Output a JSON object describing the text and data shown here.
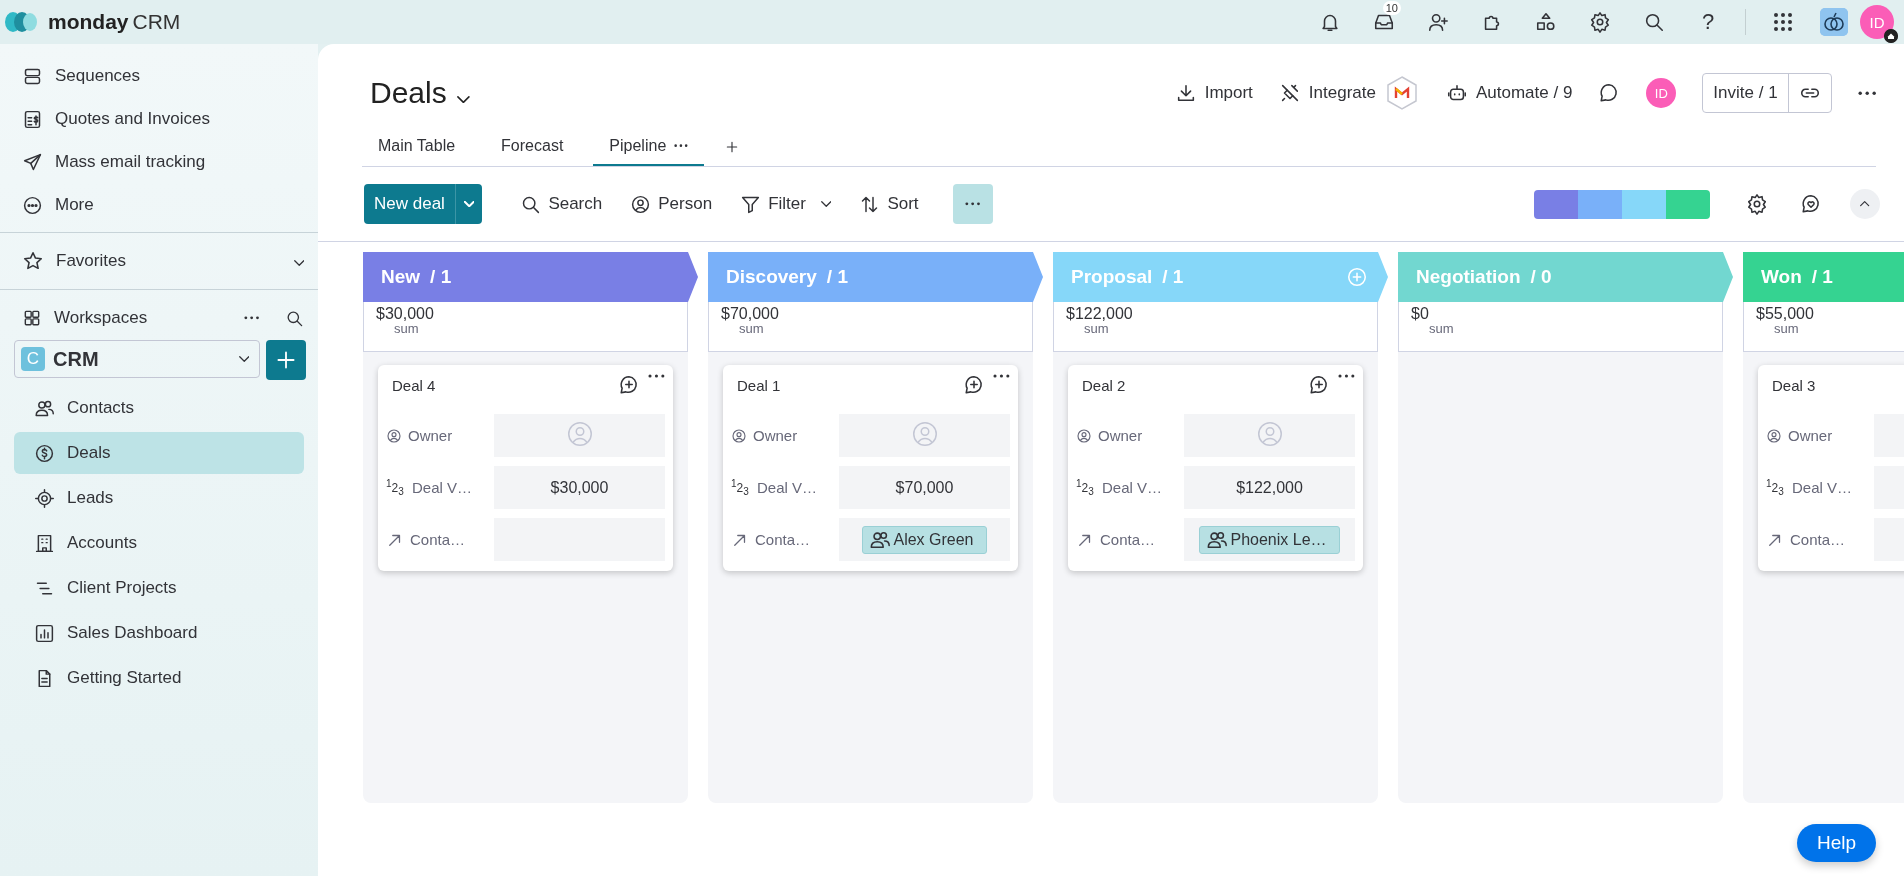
{
  "topbar": {
    "logo_bold": "monday",
    "logo_product": "CRM",
    "inbox_badge": "10",
    "help_glyph": "?",
    "avatar_initials": "ID"
  },
  "sidebar": {
    "top_items": [
      {
        "label": "Sequences"
      },
      {
        "label": "Quotes and Invoices"
      },
      {
        "label": "Mass email tracking"
      },
      {
        "label": "More"
      }
    ],
    "favorites": "Favorites",
    "workspaces": "Workspaces",
    "workspace_picker": {
      "badge": "C",
      "name": "CRM"
    },
    "items": [
      {
        "label": "Contacts",
        "selected": false
      },
      {
        "label": "Deals",
        "selected": true
      },
      {
        "label": "Leads",
        "selected": false
      },
      {
        "label": "Accounts",
        "selected": false
      },
      {
        "label": "Client Projects",
        "selected": false
      },
      {
        "label": "Sales Dashboard",
        "selected": false
      },
      {
        "label": "Getting Started",
        "selected": false
      }
    ]
  },
  "header": {
    "title": "Deals",
    "actions": [
      {
        "label": "Import"
      },
      {
        "label": "Integrate"
      },
      {
        "label": "Automate / 9"
      }
    ],
    "avatar_initials": "ID",
    "invite": "Invite / 1",
    "tabs": [
      {
        "label": "Main Table",
        "selected": false
      },
      {
        "label": "Forecast",
        "selected": false
      },
      {
        "label": "Pipeline",
        "selected": true
      }
    ]
  },
  "toolbar": {
    "new_button": "New deal",
    "tools": [
      {
        "label": "Search"
      },
      {
        "label": "Person"
      },
      {
        "label": "Filter"
      },
      {
        "label": "Sort"
      }
    ],
    "color_legend": [
      {
        "color": "#797fe5"
      },
      {
        "color": "#79b0f9"
      },
      {
        "color": "#86d7f9"
      },
      {
        "color": "#35d391"
      }
    ]
  },
  "board": {
    "columns": [
      {
        "title": "New",
        "count": "/ 1",
        "color": "#797fe5",
        "add_button": false,
        "sum": "$30,000",
        "sum_label": "sum",
        "cards": [
          {
            "title": "Deal 4",
            "fields": [
              {
                "kind": "person",
                "label": "Owner"
              },
              {
                "kind": "number",
                "glyph": "$^{1}$2$_{3}$",
                "label": "Deal V…",
                "value": "$30,000"
              },
              {
                "kind": "contact",
                "label": "Conta…"
              }
            ]
          }
        ]
      },
      {
        "title": "Discovery",
        "count": "/ 1",
        "color": "#79b0f9",
        "add_button": false,
        "sum": "$70,000",
        "sum_label": "sum",
        "cards": [
          {
            "title": "Deal 1",
            "fields": [
              {
                "kind": "person",
                "label": "Owner"
              },
              {
                "kind": "number",
                "glyph": "$^{1}$2$_{3}$",
                "label": "Deal V…",
                "value": "$70,000"
              },
              {
                "kind": "contact",
                "label": "Conta…",
                "value": "Alex Green"
              }
            ]
          }
        ]
      },
      {
        "title": "Proposal",
        "count": "/ 1",
        "color": "#86d7f9",
        "add_button": true,
        "sum": "$122,000",
        "sum_label": "sum",
        "cards": [
          {
            "title": "Deal 2",
            "fields": [
              {
                "kind": "person",
                "label": "Owner"
              },
              {
                "kind": "number",
                "glyph": "$^{1}$2$_{3}$",
                "label": "Deal V…",
                "value": "$122,000"
              },
              {
                "kind": "contact",
                "label": "Conta…",
                "value": "Phoenix Le…"
              }
            ]
          }
        ]
      },
      {
        "title": "Negotiation",
        "count": "/ 0",
        "color": "#72d7d0",
        "add_button": false,
        "sum": "$0",
        "sum_label": "sum"
      },
      {
        "title": "Won",
        "count": "/ 1",
        "color": "#35d391",
        "sum": "$55,000",
        "sum_label": "sum",
        "cards": [
          {
            "title": "Deal 3",
            "fields": [
              {
                "kind": "person",
                "label": "Owner"
              },
              {
                "kind": "number",
                "glyph": "$^{1}$2$_{3}$",
                "label": "Deal V…"
              },
              {
                "kind": "contact",
                "label": "Conta…"
              }
            ]
          }
        ]
      }
    ]
  },
  "help_button": "Help"
}
